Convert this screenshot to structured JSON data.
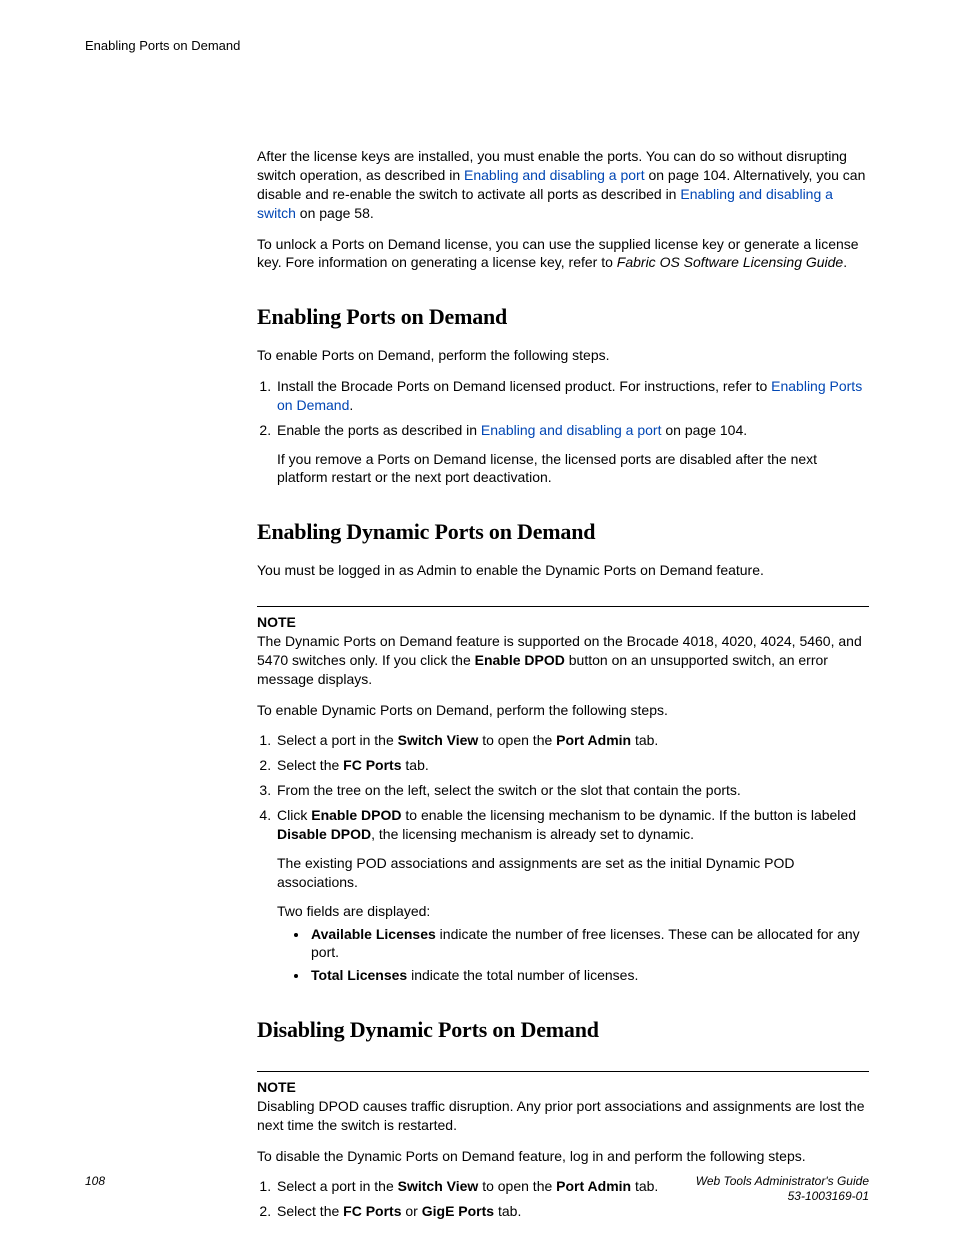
{
  "running_head": "Enabling Ports on Demand",
  "intro": {
    "p1_a": "After the license keys are installed, you must enable the ports. You can do so without disrupting switch operation, as described in ",
    "p1_link1": "Enabling and disabling a port",
    "p1_b": " on page 104. Alternatively, you can disable and re-enable the switch to activate all ports as described in ",
    "p1_link2": "Enabling and disabling a switch",
    "p1_c": " on page 58.",
    "p2_a": "To unlock a Ports on Demand license, you can use the supplied license key or generate a license key. Fore information on generating a license key, refer to ",
    "p2_em": "Fabric OS Software Licensing Guide",
    "p2_b": "."
  },
  "sec1": {
    "title": "Enabling Ports on Demand",
    "lead": "To enable Ports on Demand, perform the following steps.",
    "s1_a": "Install the Brocade Ports on Demand licensed product. For instructions, refer to ",
    "s1_link": "Enabling Ports on Demand",
    "s1_b": ".",
    "s2_a": "Enable the ports as described in ",
    "s2_link": "Enabling and disabling a port",
    "s2_b": " on page 104.",
    "s2_aux": "If you remove a Ports on Demand license, the licensed ports are disabled after the next platform restart or the next port deactivation."
  },
  "sec2": {
    "title": "Enabling Dynamic Ports on Demand",
    "lead": "You must be logged in as Admin to enable the Dynamic Ports on Demand feature.",
    "note_hd": "NOTE",
    "note_a": "The Dynamic Ports on Demand feature is supported on the Brocade 4018, 4020, 4024, 5460, and 5470 switches only. If you click the ",
    "note_b1": "Enable DPOD",
    "note_b": " button on an unsupported switch, an error message displays.",
    "lead2": "To enable Dynamic Ports on Demand, perform the following steps.",
    "s1_a": "Select a port in the ",
    "s1_b1": "Switch View",
    "s1_b": " to open the ",
    "s1_b2": "Port Admin",
    "s1_c": " tab.",
    "s2_a": "Select the ",
    "s2_b1": "FC Ports",
    "s2_b": " tab.",
    "s3": "From the tree on the left, select the switch or the slot that contain the ports.",
    "s4_a": "Click ",
    "s4_b1": "Enable DPOD",
    "s4_b": " to enable the licensing mechanism to be dynamic. If the button is labeled ",
    "s4_b2": "Disable DPOD",
    "s4_c": ", the licensing mechanism is already set to dynamic.",
    "s4_aux1": "The existing POD associations and assignments are set as the initial Dynamic POD associations.",
    "s4_aux2": "Two fields are displayed:",
    "bul1_b": "Available Licenses",
    "bul1_t": " indicate the number of free licenses. These can be allocated for any port.",
    "bul2_b": "Total Licenses",
    "bul2_t": " indicate the total number of licenses."
  },
  "sec3": {
    "title": "Disabling Dynamic Ports on Demand",
    "note_hd": "NOTE",
    "note": "Disabling DPOD causes traffic disruption. Any prior port associations and assignments are lost the next time the switch is restarted.",
    "lead": "To disable the Dynamic Ports on Demand feature, log in and perform the following steps.",
    "s1_a": "Select a port in the ",
    "s1_b1": "Switch View",
    "s1_b": " to open the ",
    "s1_b2": "Port Admin",
    "s1_c": " tab.",
    "s2_a": "Select the ",
    "s2_b1": "FC Ports",
    "s2_b": " or ",
    "s2_b2": "GigE Ports",
    "s2_c": " tab."
  },
  "footer": {
    "page": "108",
    "title": "Web Tools Administrator's Guide",
    "docnum": "53-1003169-01"
  }
}
